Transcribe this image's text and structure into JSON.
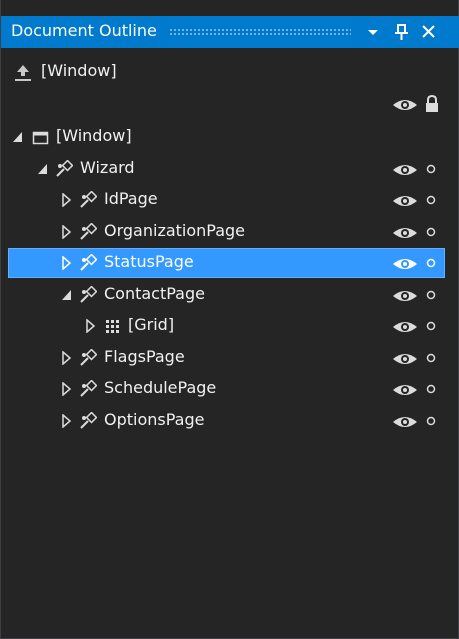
{
  "window_title": "Document Outline",
  "header": {
    "label": "[Window]"
  },
  "tree": [
    {
      "label": "[Window]",
      "state": "expanded",
      "icon": "window-icon",
      "show_toggles": false
    },
    {
      "label": "Wizard",
      "state": "expanded",
      "icon": "control-icon",
      "show_toggles": true
    },
    {
      "label": "IdPage",
      "state": "collapsed",
      "icon": "control-icon",
      "show_toggles": true
    },
    {
      "label": "OrganizationPage",
      "state": "collapsed",
      "icon": "control-icon",
      "show_toggles": true
    },
    {
      "label": "StatusPage",
      "state": "collapsed",
      "icon": "control-icon",
      "show_toggles": true,
      "selected": true
    },
    {
      "label": "ContactPage",
      "state": "expanded",
      "icon": "control-icon",
      "show_toggles": true
    },
    {
      "label": "[Grid]",
      "state": "collapsed",
      "icon": "grid-icon",
      "show_toggles": true
    },
    {
      "label": "FlagsPage",
      "state": "collapsed",
      "icon": "control-icon",
      "show_toggles": true
    },
    {
      "label": "SchedulePage",
      "state": "collapsed",
      "icon": "control-icon",
      "show_toggles": true
    },
    {
      "label": "OptionsPage",
      "state": "collapsed",
      "icon": "control-icon",
      "show_toggles": true
    }
  ],
  "colors": {
    "title_bar": "#007acc",
    "background": "#252526",
    "selection": "#3399ff",
    "text": "#f1f1f1"
  }
}
